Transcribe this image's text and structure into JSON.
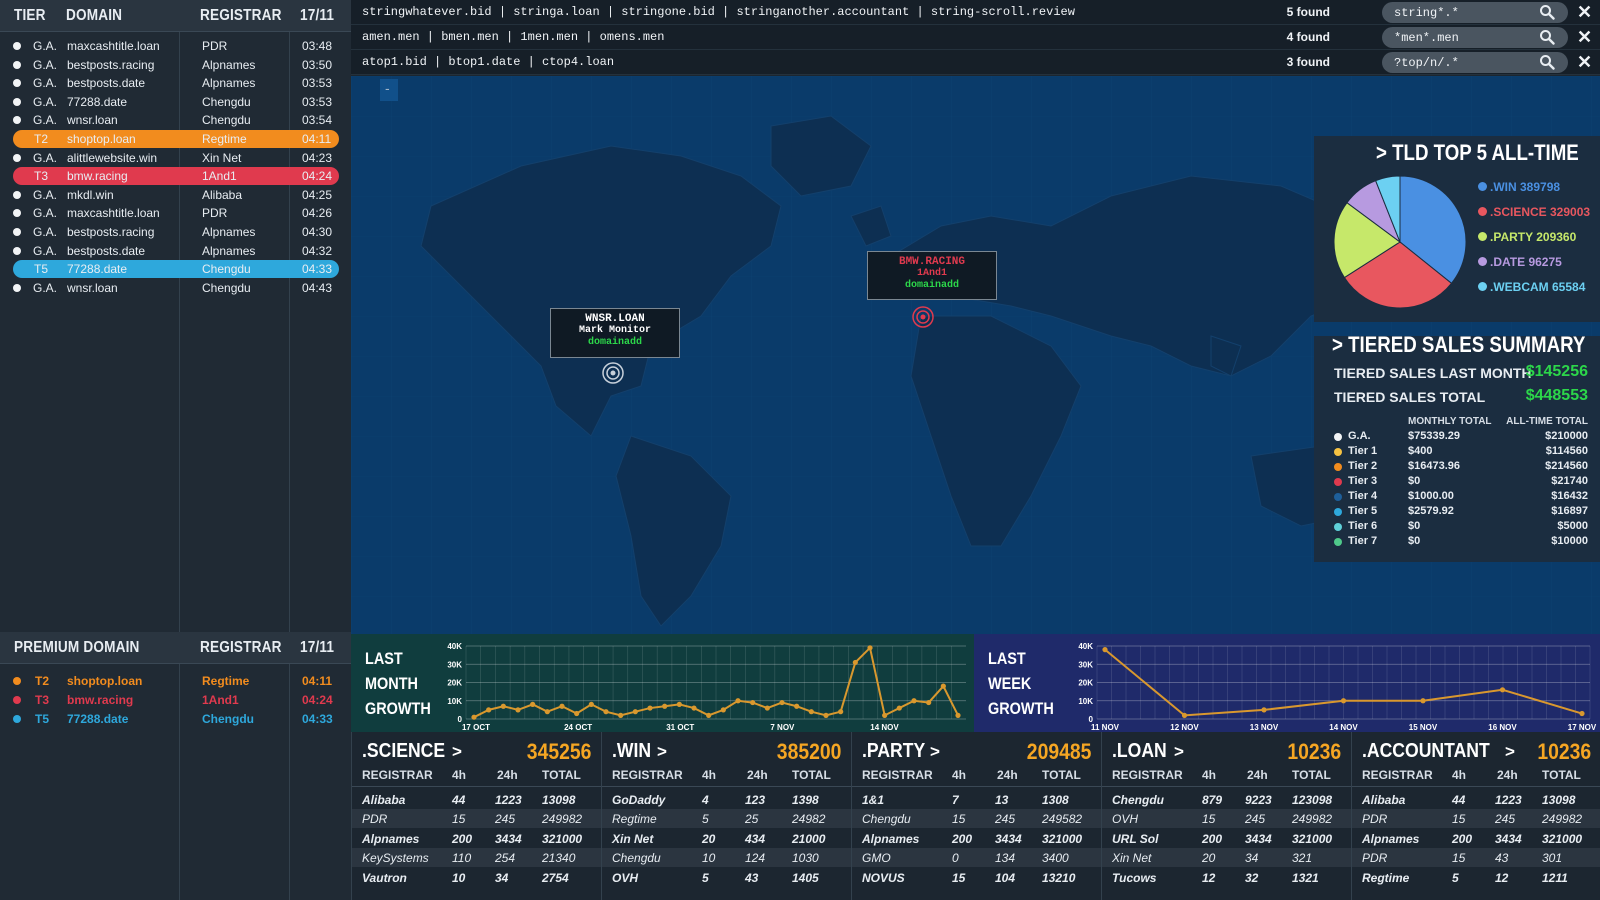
{
  "left": {
    "headers": {
      "tier": "TIER",
      "domain": "DOMAIN",
      "registrar": "REGISTRAR",
      "date": "17/11"
    },
    "rows": [
      {
        "tier": "G.A.",
        "domain": "maxcashtitle.loan",
        "registrar": "PDR",
        "time": "03:48"
      },
      {
        "tier": "G.A.",
        "domain": "bestposts.racing",
        "registrar": "Alpnames",
        "time": "03:50"
      },
      {
        "tier": "G.A.",
        "domain": "bestposts.date",
        "registrar": "Alpnames",
        "time": "03:53"
      },
      {
        "tier": "G.A.",
        "domain": "77288.date",
        "registrar": "Chengdu",
        "time": "03:53"
      },
      {
        "tier": "G.A.",
        "domain": "wnsr.loan",
        "registrar": "Chengdu",
        "time": "03:54"
      },
      {
        "tier": "T2",
        "domain": "shoptop.loan",
        "registrar": "Regtime",
        "time": "04:11"
      },
      {
        "tier": "G.A.",
        "domain": "alittlewebsite.win",
        "registrar": "Xin Net",
        "time": "04:23"
      },
      {
        "tier": "T3",
        "domain": "bmw.racing",
        "registrar": "1And1",
        "time": "04:24"
      },
      {
        "tier": "G.A.",
        "domain": "mkdl.win",
        "registrar": "Alibaba",
        "time": "04:25"
      },
      {
        "tier": "G.A.",
        "domain": "maxcashtitle.loan",
        "registrar": "PDR",
        "time": "04:26"
      },
      {
        "tier": "G.A.",
        "domain": "bestposts.racing",
        "registrar": "Alpnames",
        "time": "04:30"
      },
      {
        "tier": "G.A.",
        "domain": "bestposts.date",
        "registrar": "Alpnames",
        "time": "04:32"
      },
      {
        "tier": "T5",
        "domain": "77288.date",
        "registrar": "Chengdu",
        "time": "04:33"
      },
      {
        "tier": "G.A.",
        "domain": "wnsr.loan",
        "registrar": "Chengdu",
        "time": "04:43"
      }
    ],
    "premium_headers": {
      "domain": "PREMIUM DOMAIN",
      "registrar": "REGISTRAR",
      "date": "17/11"
    },
    "premium_rows": [
      {
        "tier": "T2",
        "domain": "shoptop.loan",
        "registrar": "Regtime",
        "time": "04:11",
        "color": "#f28c1e"
      },
      {
        "tier": "T3",
        "domain": "bmw.racing",
        "registrar": "1And1",
        "time": "04:24",
        "color": "#e03a4e"
      },
      {
        "tier": "T5",
        "domain": "77288.date",
        "registrar": "Chengdu",
        "time": "04:33",
        "color": "#2ea8dc"
      }
    ]
  },
  "search": [
    {
      "list": "stringwhatever.bid | stringa.loan | stringone.bid | stringanother.accountant | string-scroll.review",
      "found": "5 found",
      "query": "string*.*"
    },
    {
      "list": "amen.men | bmen.men | 1men.men | omens.men",
      "found": "4 found",
      "query": "*men*.men"
    },
    {
      "list": "atop1.bid | btop1.date | ctop4.loan",
      "found": "3 found",
      "query": "?top/n/.*"
    }
  ],
  "map": {
    "zoom_label": "-",
    "markers": [
      {
        "domain": "WNSR.LOAN",
        "registrar": "Mark Monitor",
        "source": "domainadd"
      },
      {
        "domain": "BMW.RACING",
        "registrar": "1And1",
        "source": "domainadd"
      }
    ]
  },
  "tld_top5": {
    "title": "TLD TOP 5 ALL-TIME",
    "items": [
      {
        "label": ".WIN 389798",
        "value": 389798,
        "color": "#4a90e2"
      },
      {
        "label": ".SCIENCE 329003",
        "value": 329003,
        "color": "#e8575f"
      },
      {
        "label": ".PARTY 209360",
        "value": 209360,
        "color": "#c6e86a"
      },
      {
        "label": ".DATE 96275",
        "value": 96275,
        "color": "#b79ae0"
      },
      {
        "label": ".WEBCAM 65584",
        "value": 65584,
        "color": "#6cd0f2"
      }
    ]
  },
  "tiered": {
    "title": "TIERED SALES SUMMARY",
    "last_month_label": "TIERED SALES LAST MONTH",
    "last_month_value": "$145256",
    "total_label": "TIERED SALES TOTAL",
    "total_value": "$448553",
    "col_monthly": "MONTHLY TOTAL",
    "col_alltime": "ALL-TIME TOTAL",
    "rows": [
      {
        "name": "G.A.",
        "monthly": "$75339.29",
        "alltime": "$210000",
        "color": "#f2f4f6"
      },
      {
        "name": "Tier 1",
        "monthly": "$400",
        "alltime": "$114560",
        "color": "#f5c242"
      },
      {
        "name": "Tier 2",
        "monthly": "$16473.96",
        "alltime": "$214560",
        "color": "#f28c1e"
      },
      {
        "name": "Tier 3",
        "monthly": "$0",
        "alltime": "$21740",
        "color": "#e03a4e"
      },
      {
        "name": "Tier 4",
        "monthly": "$1000.00",
        "alltime": "$16432",
        "color": "#1e5f9a"
      },
      {
        "name": "Tier 5",
        "monthly": "$2579.92",
        "alltime": "$16897",
        "color": "#2ea8dc"
      },
      {
        "name": "Tier 6",
        "monthly": "$0",
        "alltime": "$5000",
        "color": "#5fd0d8"
      },
      {
        "name": "Tier 7",
        "monthly": "$0",
        "alltime": "$10000",
        "color": "#4fc98a"
      }
    ]
  },
  "chart_data": [
    {
      "type": "line",
      "title": "LAST MONTH GROWTH",
      "title_lines": [
        "LAST",
        "MONTH",
        "GROWTH"
      ],
      "y_ticks": [
        "40K",
        "30K",
        "20K",
        "10K",
        "0"
      ],
      "ylim": [
        0,
        40000
      ],
      "x_ticks": [
        "17 OCT",
        "24 OCT",
        "31 OCT",
        "7 NOV",
        "14 NOV"
      ],
      "series": [
        {
          "values": [
            1000,
            5000,
            7000,
            5000,
            8000,
            4000,
            7000,
            3000,
            8000,
            4000,
            2000,
            4000,
            6000,
            7000,
            8000,
            6000,
            2000,
            5000,
            10000,
            9000,
            6000,
            9000,
            7000,
            4000,
            2000,
            4000,
            31000,
            39000,
            2000,
            6000,
            10000,
            9000,
            18000,
            2000
          ]
        }
      ],
      "line_color": "#d9982e"
    },
    {
      "type": "line",
      "title": "LAST WEEK GROWTH",
      "title_lines": [
        "LAST",
        "WEEK",
        "GROWTH"
      ],
      "y_ticks": [
        "40K",
        "30K",
        "20K",
        "10K",
        "0"
      ],
      "ylim": [
        0,
        40000
      ],
      "x_ticks": [
        "11 NOV",
        "12 NOV",
        "13 NOV",
        "14 NOV",
        "15 NOV",
        "16 NOV",
        "17 NOV"
      ],
      "x": [
        "11 NOV",
        "12 NOV",
        "13 NOV",
        "14 NOV",
        "15 NOV",
        "16 NOV",
        "17 NOV"
      ],
      "series": [
        {
          "values": [
            38000,
            2000,
            5000,
            10000,
            10000,
            16000,
            3000
          ]
        }
      ],
      "line_color": "#d9982e"
    }
  ],
  "tables": [
    {
      "name": ".SCIENCE",
      "total": "345256",
      "cols": [
        "REGISTRAR",
        "4h",
        "24h",
        "TOTAL"
      ],
      "rows": [
        [
          "Alibaba",
          "44",
          "1223",
          "13098"
        ],
        [
          "PDR",
          "15",
          "245",
          "249982"
        ],
        [
          "Alpnames",
          "200",
          "3434",
          "321000"
        ],
        [
          "KeySystems",
          "110",
          "254",
          "21340"
        ],
        [
          "Vautron",
          "10",
          "34",
          "2754"
        ]
      ]
    },
    {
      "name": ".WIN",
      "total": "385200",
      "cols": [
        "REGISTRAR",
        "4h",
        "24h",
        "TOTAL"
      ],
      "rows": [
        [
          "GoDaddy",
          "4",
          "123",
          "1398"
        ],
        [
          "Regtime",
          "5",
          "25",
          "24982"
        ],
        [
          "Xin Net",
          "20",
          "434",
          "21000"
        ],
        [
          "Chengdu",
          "10",
          "124",
          "1030"
        ],
        [
          "OVH",
          "5",
          "43",
          "1405"
        ]
      ]
    },
    {
      "name": ".PARTY",
      "total": "209485",
      "cols": [
        "REGISTRAR",
        "4h",
        "24h",
        "TOTAL"
      ],
      "rows": [
        [
          "1&1",
          "7",
          "13",
          "1308"
        ],
        [
          "Chengdu",
          "15",
          "245",
          "249582"
        ],
        [
          "Alpnames",
          "200",
          "3434",
          "321000"
        ],
        [
          "GMO",
          "0",
          "134",
          "3400"
        ],
        [
          "NOVUS",
          "15",
          "104",
          "13210"
        ]
      ]
    },
    {
      "name": ".LOAN",
      "total": "10236",
      "cols": [
        "REGISTRAR",
        "4h",
        "24h",
        "TOTAL"
      ],
      "rows": [
        [
          "Chengdu",
          "879",
          "9223",
          "123098"
        ],
        [
          "OVH",
          "15",
          "245",
          "249982"
        ],
        [
          "URL Sol",
          "200",
          "3434",
          "321000"
        ],
        [
          "Xin Net",
          "20",
          "34",
          "321"
        ],
        [
          "Tucows",
          "12",
          "32",
          "1321"
        ]
      ]
    },
    {
      "name": ".ACCOUNTANT",
      "total": "10236",
      "cols": [
        "REGISTRAR",
        "4h",
        "24h",
        "TOTAL"
      ],
      "rows": [
        [
          "Alibaba",
          "44",
          "1223",
          "13098"
        ],
        [
          "PDR",
          "15",
          "245",
          "249982"
        ],
        [
          "Alpnames",
          "200",
          "3434",
          "321000"
        ],
        [
          "PDR",
          "15",
          "43",
          "301"
        ],
        [
          "Regtime",
          "5",
          "12",
          "1211"
        ]
      ]
    }
  ]
}
